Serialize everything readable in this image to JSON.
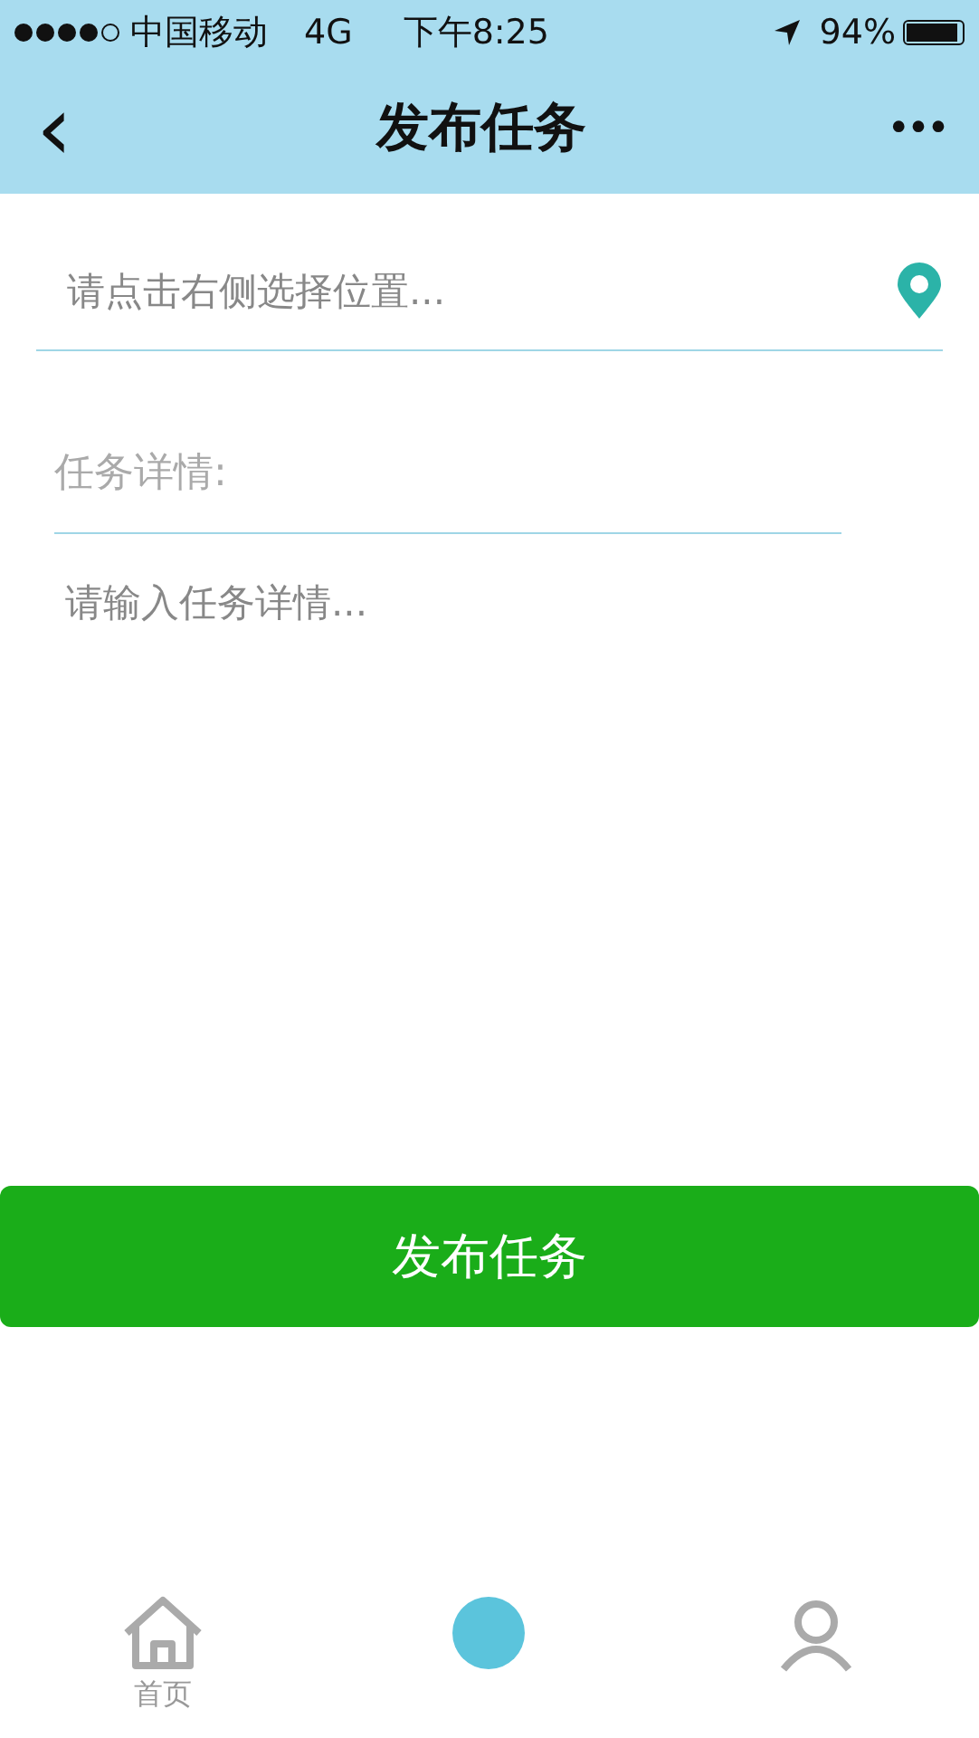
{
  "status_bar": {
    "signal_dots": [
      {
        "filled": true
      },
      {
        "filled": true
      },
      {
        "filled": true
      },
      {
        "filled": true
      },
      {
        "filled": false
      }
    ],
    "carrier": "中国移动",
    "network": "4G",
    "time": "下午8:25",
    "battery_text": "94%",
    "battery": {
      "level": 0.94
    }
  },
  "nav": {
    "back": "‹",
    "title": "发布任务",
    "more": "•••"
  },
  "location_field": {
    "placeholder": "请点击右侧选择位置..."
  },
  "detail_label": "任务详情:",
  "detail_field": {
    "placeholder": "请输入任务详情..."
  },
  "submit_button": "发布任务",
  "tab_bar": [
    {
      "kind": "home",
      "label": "首页",
      "selected": false
    },
    {
      "kind": "publish",
      "selected": true
    },
    {
      "kind": "mine",
      "selected": false
    }
  ]
}
